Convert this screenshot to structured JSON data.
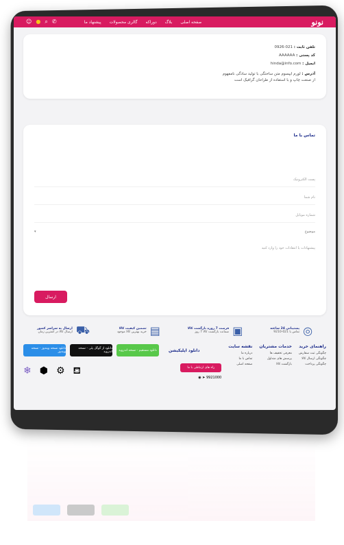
{
  "header": {
    "brand": "نونو",
    "menu": [
      "صفحه اصلی",
      "بلاگ",
      "دوراکه",
      "گالری محصولات",
      "پیشنهاد ما"
    ],
    "icons": [
      "user-icon",
      "cart-icon",
      "search-icon",
      "phone-icon"
    ]
  },
  "info": {
    "phone_label": "تلفن ثابت :",
    "phone_value": "021-0926",
    "postal_label": "کد پستی :",
    "postal_value": "AAAAAA",
    "email_label": "ایمیل :",
    "email_value": "hinda@info.com",
    "address_label": "آدرس :",
    "address_value": "لورم ایپسوم متن ساختگی با تولید سادگی نامفهوم",
    "address_value2": "از صنعت چاپ و با استفاده از طراحان گرافیک است"
  },
  "contact": {
    "title": "تماس با ما",
    "email_placeholder": "پست الکترونیک",
    "name_placeholder": "نام شما",
    "subject_placeholder": "شماره موبایل",
    "select_value": "موضوع",
    "message_placeholder": "پیشنهادات یا انتقادات خود را وارد کنید",
    "send_label": "ارسال"
  },
  "features": [
    {
      "icon": "headset-icon",
      "title": "پشتیبانی 24 ساعته",
      "sub": "تماس با 021-9210"
    },
    {
      "icon": "return-icon",
      "title": "فرصت 7 روزه بازگشت کالا",
      "sub": "ضمانت بازگشت کالا 7 روز"
    },
    {
      "icon": "receipt-icon",
      "title": "تضمین کیفیت کالا",
      "sub": "خرید بهترین کالا موجود"
    },
    {
      "icon": "delivery-icon",
      "title": "ارسال به سراسر کشور",
      "sub": "ارسال کالا در کمترین زمان"
    }
  ],
  "footer": {
    "guide_title": "راهنمای خرید",
    "guide_items": [
      "چگونگی ثبت سفارش",
      "چگونگی ارسال کالا",
      "چگونگی پرداخت"
    ],
    "customer_title": "خدمات مشتریان",
    "customer_items": [
      "معرفی تخفیف ها",
      "پرسش های متداول",
      "بازگشت کالا"
    ],
    "sitemap_title": "نقشه سایت",
    "sitemap_items": [
      "درباره ما",
      "تماس با ما",
      "صفحه اصلی"
    ],
    "download_title": "دانلود اپلیکیشن",
    "store_buttons": [
      "دانلود مستقیم - نسخه اندروید",
      "دانلود از گوگل پلی - نسخه اندروید",
      "دانلود نسخه ویندوز - نسخه ویندوز"
    ],
    "social_label": "راه های ارتباطی با ما",
    "phone": "9921000",
    "badge_icons": [
      "enamad-icon",
      "samandehi-icon",
      "emblem-icon",
      "ecommerce-icon",
      "snowflake-icon"
    ]
  },
  "colors": {
    "accent": "#d81b60",
    "navy": "#1a2a8a"
  }
}
